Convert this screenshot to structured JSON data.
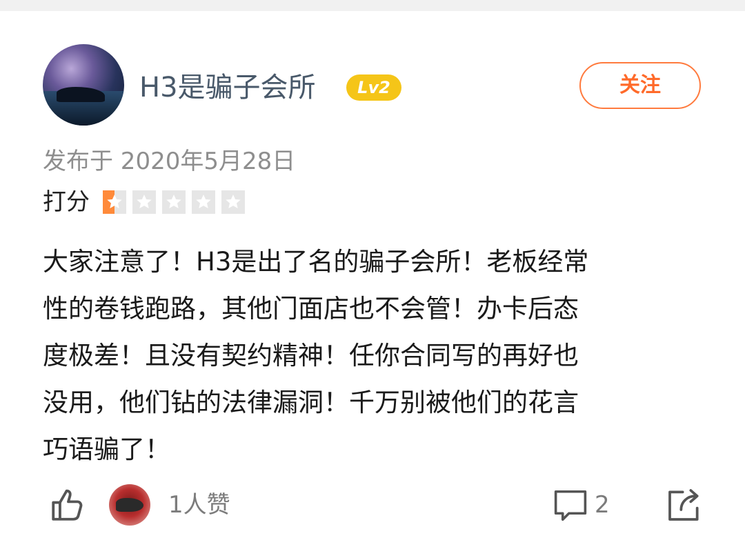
{
  "user": {
    "name": "H3是骗子会所",
    "level": "Lv2",
    "follow_label": "关注"
  },
  "post": {
    "date": "发布于 2020年5月28日",
    "rating_label": "打分",
    "rating": {
      "value": 0.5,
      "max": 5
    },
    "review_lines": [
      "大家注意了！H3是出了名的骗子会所！老板经常",
      "性的卷钱跑路，其他门面店也不会管！办卡后态",
      "度极差！且没有契约精神！任你合同写的再好也",
      "没用，他们钻的法律漏洞！千万别被他们的花言",
      "巧语骗了！"
    ]
  },
  "actions": {
    "like_icon": "thumbs-up-icon",
    "likes_text": "1人赞",
    "comment_icon": "comment-icon",
    "comment_count": "2",
    "share_icon": "share-icon"
  },
  "colors": {
    "accent": "#ff6a2a",
    "level_badge": "#f5c518",
    "star_active": "#ff8a3a",
    "star_inactive": "#e6e6e6"
  }
}
